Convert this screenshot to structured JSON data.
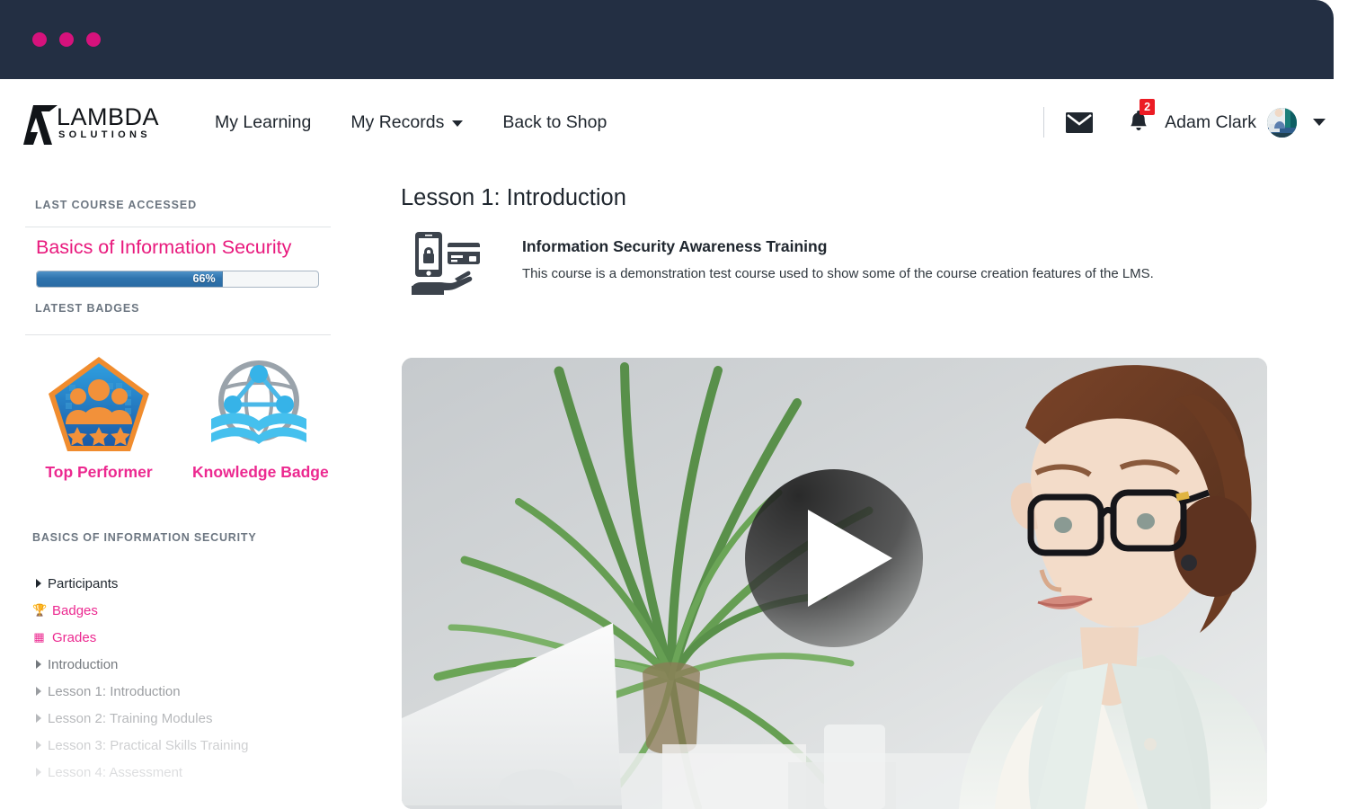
{
  "window": {
    "dots": [
      "dot-1",
      "dot-2",
      "dot-3"
    ],
    "chrome_color": "#232f43",
    "dot_color": "#d6127c"
  },
  "brand": {
    "name": "LAMBDA",
    "tagline": "SOLUTIONS",
    "accent_color": "#e8197d"
  },
  "nav": {
    "links": [
      {
        "label": "My Learning",
        "has_dropdown": false
      },
      {
        "label": "My Records",
        "has_dropdown": true
      },
      {
        "label": "Back to Shop",
        "has_dropdown": false
      }
    ],
    "mail_icon": "envelope-icon",
    "bell_icon": "bell-icon",
    "notification_count": "2",
    "notification_color": "#ec1c24",
    "user_name": "Adam Clark",
    "avatar": "user-avatar",
    "caret": "chevron-down-icon"
  },
  "sidebar": {
    "last_course_label": "LAST COURSE ACCESSED",
    "course": {
      "title": "Basics of Information Security",
      "progress_percent": 66,
      "progress_text": "66%"
    },
    "latest_badges_label": "LATEST BADGES",
    "badges": [
      {
        "name": "Top Performer",
        "art": "pentagon-people-stars-badge"
      },
      {
        "name": "Knowledge Badge",
        "art": "globe-book-network-badge"
      }
    ],
    "course_nav_label": "BASICS OF INFORMATION SECURITY",
    "course_nav": [
      {
        "label": "Participants",
        "icon": "triangle-right-icon",
        "style": "dark",
        "opacity": 1
      },
      {
        "label": "Badges",
        "icon": "trophy-icon",
        "style": "pink",
        "opacity": 1
      },
      {
        "label": "Grades",
        "icon": "table-icon",
        "style": "pink",
        "opacity": 1
      },
      {
        "label": "Introduction",
        "icon": "triangle-right-icon",
        "style": "dark",
        "opacity": 0.62
      },
      {
        "label": "Lesson 1: Introduction",
        "icon": "triangle-right-icon",
        "style": "dark",
        "opacity": 0.45
      },
      {
        "label": "Lesson 2: Training Modules",
        "icon": "triangle-right-icon",
        "style": "dark",
        "opacity": 0.32
      },
      {
        "label": "Lesson 3: Practical Skills Training",
        "icon": "triangle-right-icon",
        "style": "dark",
        "opacity": 0.22
      },
      {
        "label": "Lesson 4: Assessment",
        "icon": "triangle-right-icon",
        "style": "dark",
        "opacity": 0.15
      }
    ]
  },
  "main": {
    "lesson_title": "Lesson 1: Introduction",
    "course_icon": "phone-lock-creditcard-hand-icon",
    "course_heading": "Information Security Awareness Training",
    "course_description": "This course is a demonstration test course used to show some of the course creation features of the LMS.",
    "video": {
      "alt": "Woman with glasses working at a laptop beside a green plant",
      "play_button": "play-icon"
    }
  }
}
